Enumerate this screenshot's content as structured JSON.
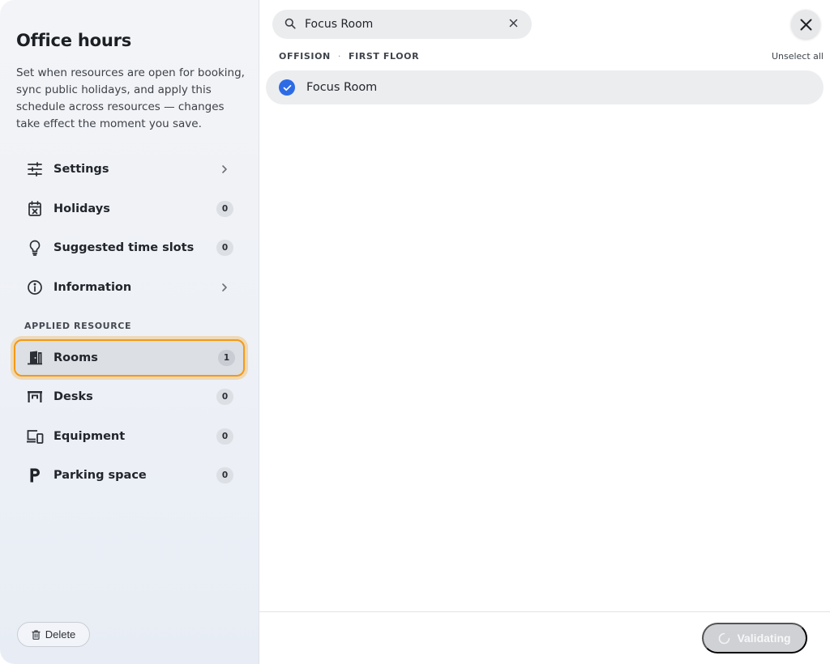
{
  "sidebar": {
    "title": "Office hours",
    "description": "Set when resources are open for booking, sync public holidays, and apply this schedule across resources — changes take effect the moment you save.",
    "nav": [
      {
        "label": "Settings",
        "icon": "sliders-icon",
        "trailing": "chevron"
      },
      {
        "label": "Holidays",
        "icon": "calendar-x-icon",
        "badge": "0"
      },
      {
        "label": "Suggested time slots",
        "icon": "lightbulb-icon",
        "badge": "0"
      },
      {
        "label": "Information",
        "icon": "info-icon",
        "trailing": "chevron"
      }
    ],
    "applied_section_label": "APPLIED RESOURCE",
    "resources": [
      {
        "label": "Rooms",
        "icon": "door-icon",
        "badge": "1",
        "selected": true
      },
      {
        "label": "Desks",
        "icon": "desk-icon",
        "badge": "0"
      },
      {
        "label": "Equipment",
        "icon": "devices-icon",
        "badge": "0"
      },
      {
        "label": "Parking space",
        "icon": "parking-icon",
        "badge": "0"
      }
    ],
    "delete_label": "Delete"
  },
  "main": {
    "search": {
      "value": "Focus Room",
      "placeholder": "Search"
    },
    "breadcrumb": {
      "building": "OFFISION",
      "separator": "·",
      "floor": "FIRST FLOOR"
    },
    "unselect_label": "Unselect all",
    "results": [
      {
        "label": "Focus Room",
        "checked": true
      }
    ],
    "validate_label": "Validating"
  },
  "colors": {
    "accent": "#2d6be6",
    "selection_ring": "#f39a12"
  }
}
